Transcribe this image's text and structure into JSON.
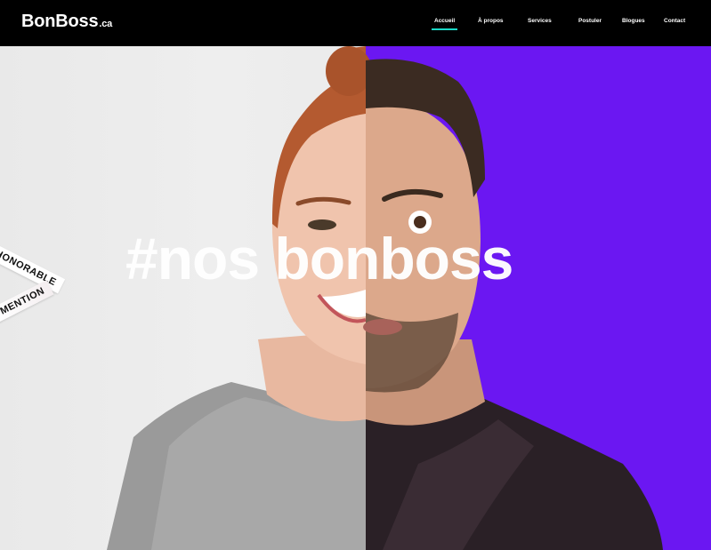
{
  "header": {
    "logo_main": "BonBoss",
    "logo_tld": ".ca",
    "nav": [
      "Accueil",
      "À propos",
      "Services",
      "Postuler",
      "Blogues",
      "Contact"
    ],
    "active_nav": "Accueil"
  },
  "hero": {
    "headline": "#nos bonboss",
    "badge_line1": "HONORABLE",
    "badge_line2": "MENTION"
  },
  "colors": {
    "header_bg": "#000000",
    "accent_underline": "#1ad7c6",
    "right_panel": "#6b17f2",
    "left_panel": "#ececec"
  }
}
